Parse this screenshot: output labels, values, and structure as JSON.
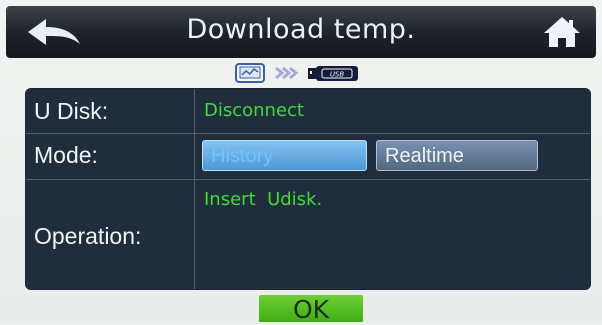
{
  "header": {
    "title": "Download temp.",
    "back_icon": "back-arrow-icon",
    "home_icon": "home-icon"
  },
  "indicator": {
    "source_icon": "chart-screen-icon",
    "arrow_icon": "double-chevron-right-icon",
    "target_icon": "usb-drive-icon",
    "target_label": "USB"
  },
  "panel": {
    "udisk": {
      "label": "U Disk:",
      "value": "Disconnect"
    },
    "mode": {
      "label": "Mode:",
      "options": [
        "History",
        "Realtime"
      ],
      "selected": "History"
    },
    "operation": {
      "label": "Operation:",
      "value": "Insert  Udisk."
    }
  },
  "footer": {
    "ok_label": "OK"
  },
  "colors": {
    "panel_bg": "#1f2d3d",
    "status_text": "#3fdc34",
    "ok_button": "#52be22",
    "header_bg": "#1e2228"
  }
}
